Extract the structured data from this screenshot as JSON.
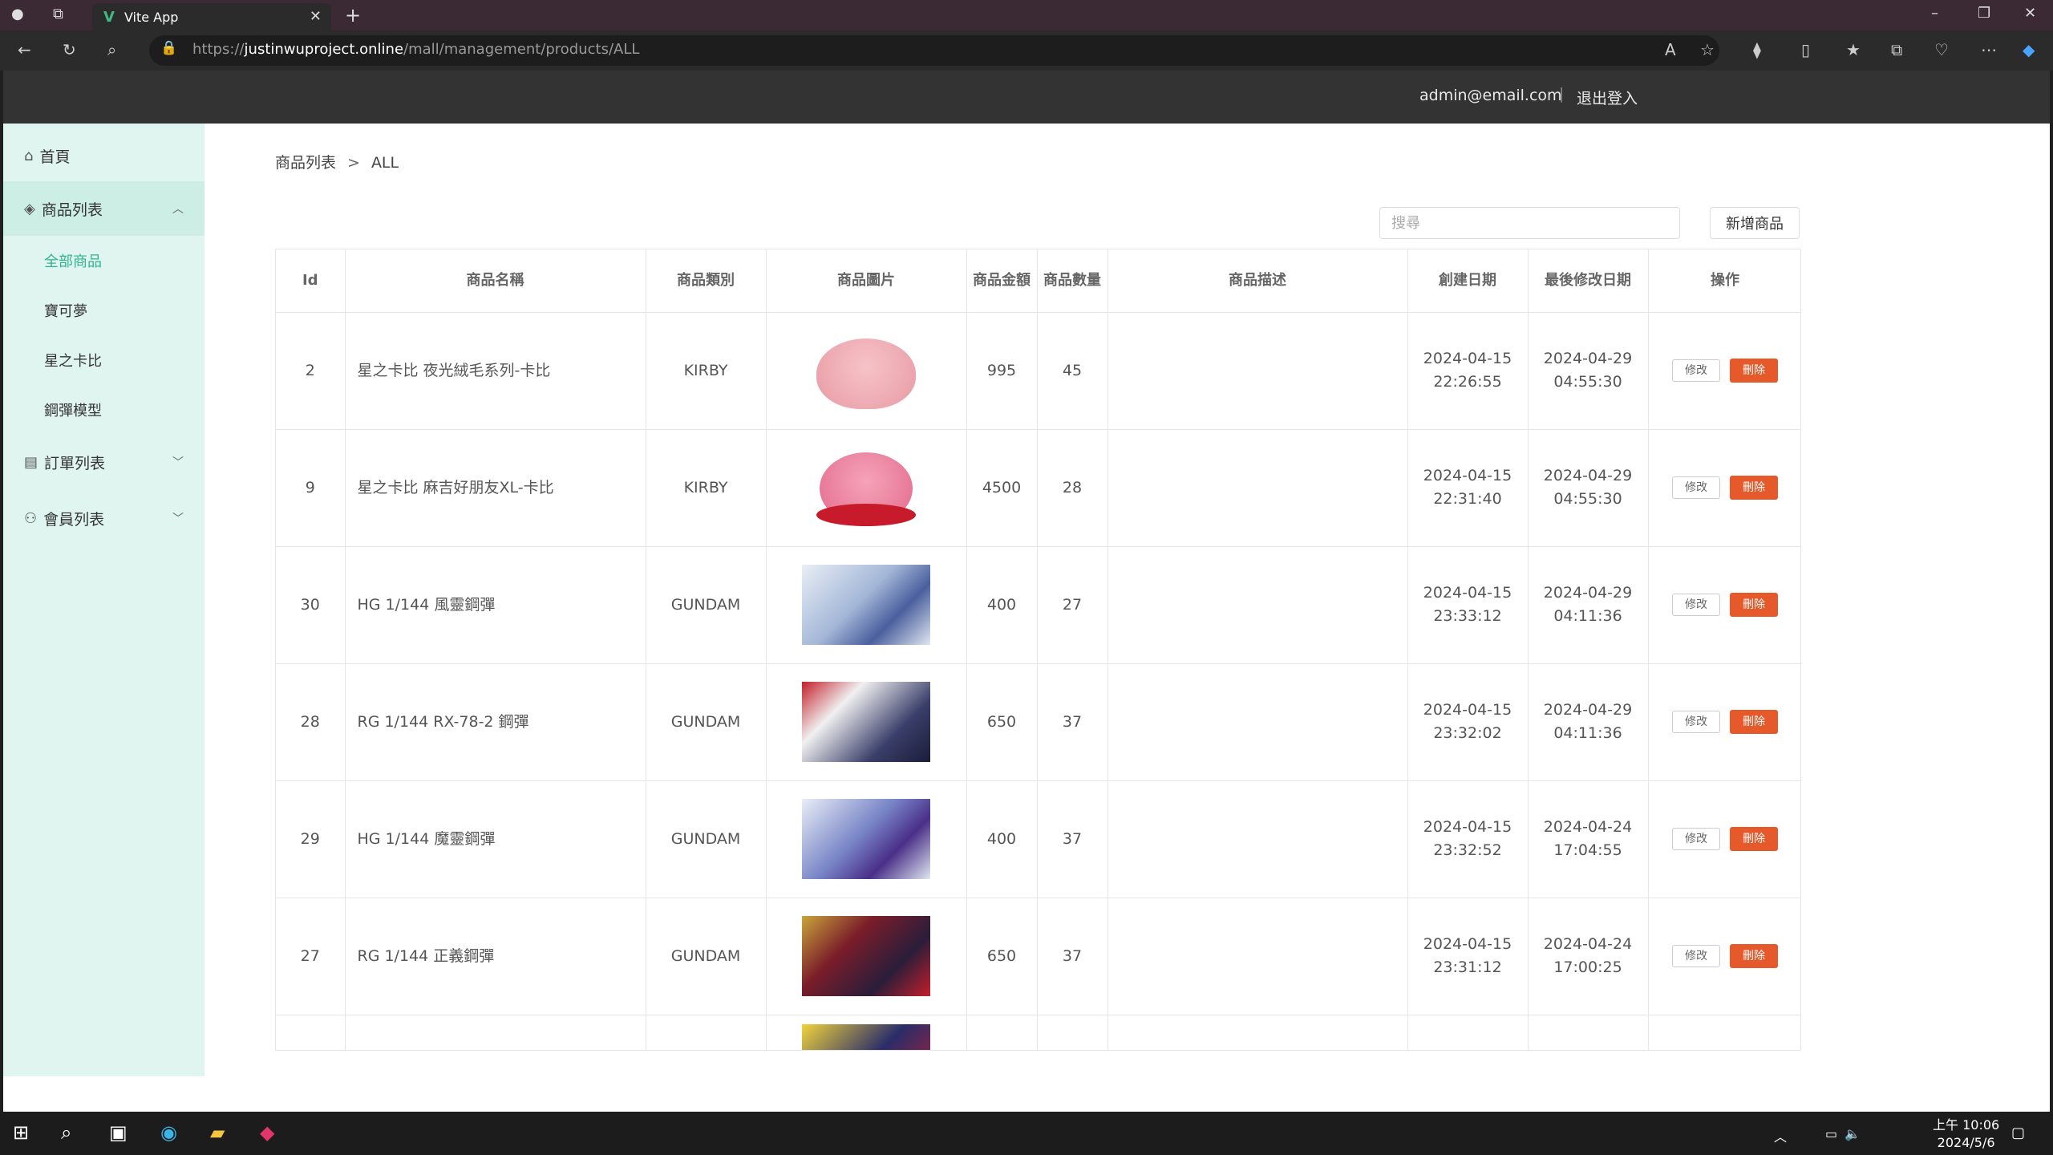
{
  "browser": {
    "tab_title": "Vite App",
    "url_prefix": "https://",
    "url_domain": "justinwuproject.online",
    "url_path": "/mall/management/products/ALL"
  },
  "header": {
    "user_email": "admin@email.com",
    "separator": "|",
    "logout_label": "退出登入"
  },
  "sidebar": {
    "home": "首頁",
    "products": "商品列表",
    "sub_items": [
      "全部商品",
      "寶可夢",
      "星之卡比",
      "鋼彈模型"
    ],
    "orders": "訂單列表",
    "members": "會員列表",
    "active_color": "#2fb48f"
  },
  "breadcrumb": {
    "root": "商品列表",
    "separator": ">",
    "current": "ALL"
  },
  "toolbar": {
    "search_placeholder": "搜尋",
    "add_label": "新增商品"
  },
  "table": {
    "headers": [
      "Id",
      "商品名稱",
      "商品類別",
      "商品圖片",
      "商品金額",
      "商品數量",
      "商品描述",
      "創建日期",
      "最後修改日期",
      "操作"
    ],
    "edit_label": "修改",
    "delete_label": "刪除",
    "rows": [
      {
        "id": "2",
        "name": "星之卡比 夜光絨毛系列-卡比",
        "category": "KIRBY",
        "price": "995",
        "qty": "45",
        "desc": "",
        "created": "2024-04-15",
        "created_time": "22:26:55",
        "modified": "2024-04-29",
        "modified_time": "04:55:30",
        "image": "kirby-plush-light"
      },
      {
        "id": "9",
        "name": "星之卡比 麻吉好朋友XL-卡比",
        "category": "KIRBY",
        "price": "4500",
        "qty": "28",
        "desc": "",
        "created": "2024-04-15",
        "created_time": "22:31:40",
        "modified": "2024-04-29",
        "modified_time": "04:55:30",
        "image": "kirby-plush-pink"
      },
      {
        "id": "30",
        "name": "HG 1/144 風靈鋼彈",
        "category": "GUNDAM",
        "price": "400",
        "qty": "27",
        "desc": "",
        "created": "2024-04-15",
        "created_time": "23:33:12",
        "modified": "2024-04-29",
        "modified_time": "04:11:36",
        "image": "gundam-aerial-box"
      },
      {
        "id": "28",
        "name": "RG 1/144 RX-78-2 鋼彈",
        "category": "GUNDAM",
        "price": "650",
        "qty": "37",
        "desc": "",
        "created": "2024-04-15",
        "created_time": "23:32:02",
        "modified": "2024-04-29",
        "modified_time": "04:11:36",
        "image": "gundam-rx78-box"
      },
      {
        "id": "29",
        "name": "HG 1/144 魔靈鋼彈",
        "category": "GUNDAM",
        "price": "400",
        "qty": "37",
        "desc": "",
        "created": "2024-04-15",
        "created_time": "23:32:52",
        "modified": "2024-04-24",
        "modified_time": "17:04:55",
        "image": "gundam-lfrith-box"
      },
      {
        "id": "27",
        "name": "RG 1/144 正義鋼彈",
        "category": "GUNDAM",
        "price": "650",
        "qty": "37",
        "desc": "",
        "created": "2024-04-15",
        "created_time": "23:31:12",
        "modified": "2024-04-24",
        "modified_time": "17:00:25",
        "image": "gundam-justice-box"
      }
    ]
  },
  "taskbar": {
    "time": "上午 10:06",
    "date": "2024/5/6"
  }
}
